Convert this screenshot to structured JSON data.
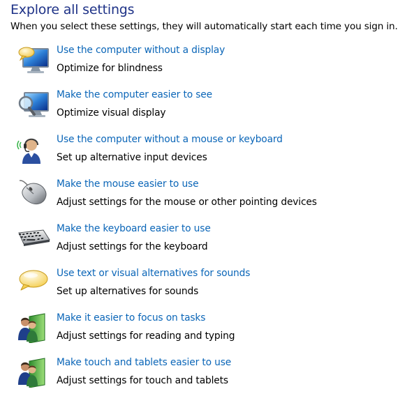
{
  "header": {
    "title": "Explore all settings",
    "subtitle": "When you select these settings, they will automatically start each time you sign in."
  },
  "items": [
    {
      "icon": "monitor-speech-bubble-icon",
      "link": "Use the computer without a display",
      "description": "Optimize for blindness"
    },
    {
      "icon": "monitor-magnifier-icon",
      "link": "Make the computer easier to see",
      "description": "Optimize visual display"
    },
    {
      "icon": "headset-person-icon",
      "link": "Use the computer without a mouse or keyboard",
      "description": "Set up alternative input devices"
    },
    {
      "icon": "mouse-icon",
      "link": "Make the mouse easier to use",
      "description": "Adjust settings for the mouse or other pointing devices"
    },
    {
      "icon": "keyboard-icon",
      "link": "Make the keyboard easier to use",
      "description": "Adjust settings for the keyboard"
    },
    {
      "icon": "speech-bubble-icon",
      "link": "Use text or visual alternatives for sounds",
      "description": "Set up alternatives for sounds"
    },
    {
      "icon": "people-panel-icon",
      "link": "Make it easier to focus on tasks",
      "description": "Adjust settings for reading and typing"
    },
    {
      "icon": "people-panel-icon",
      "link": "Make touch and tablets easier to use",
      "description": "Adjust settings for touch and tablets"
    }
  ],
  "colors": {
    "heading": "#1e3287",
    "link": "#0b66b8",
    "text": "#000000"
  }
}
